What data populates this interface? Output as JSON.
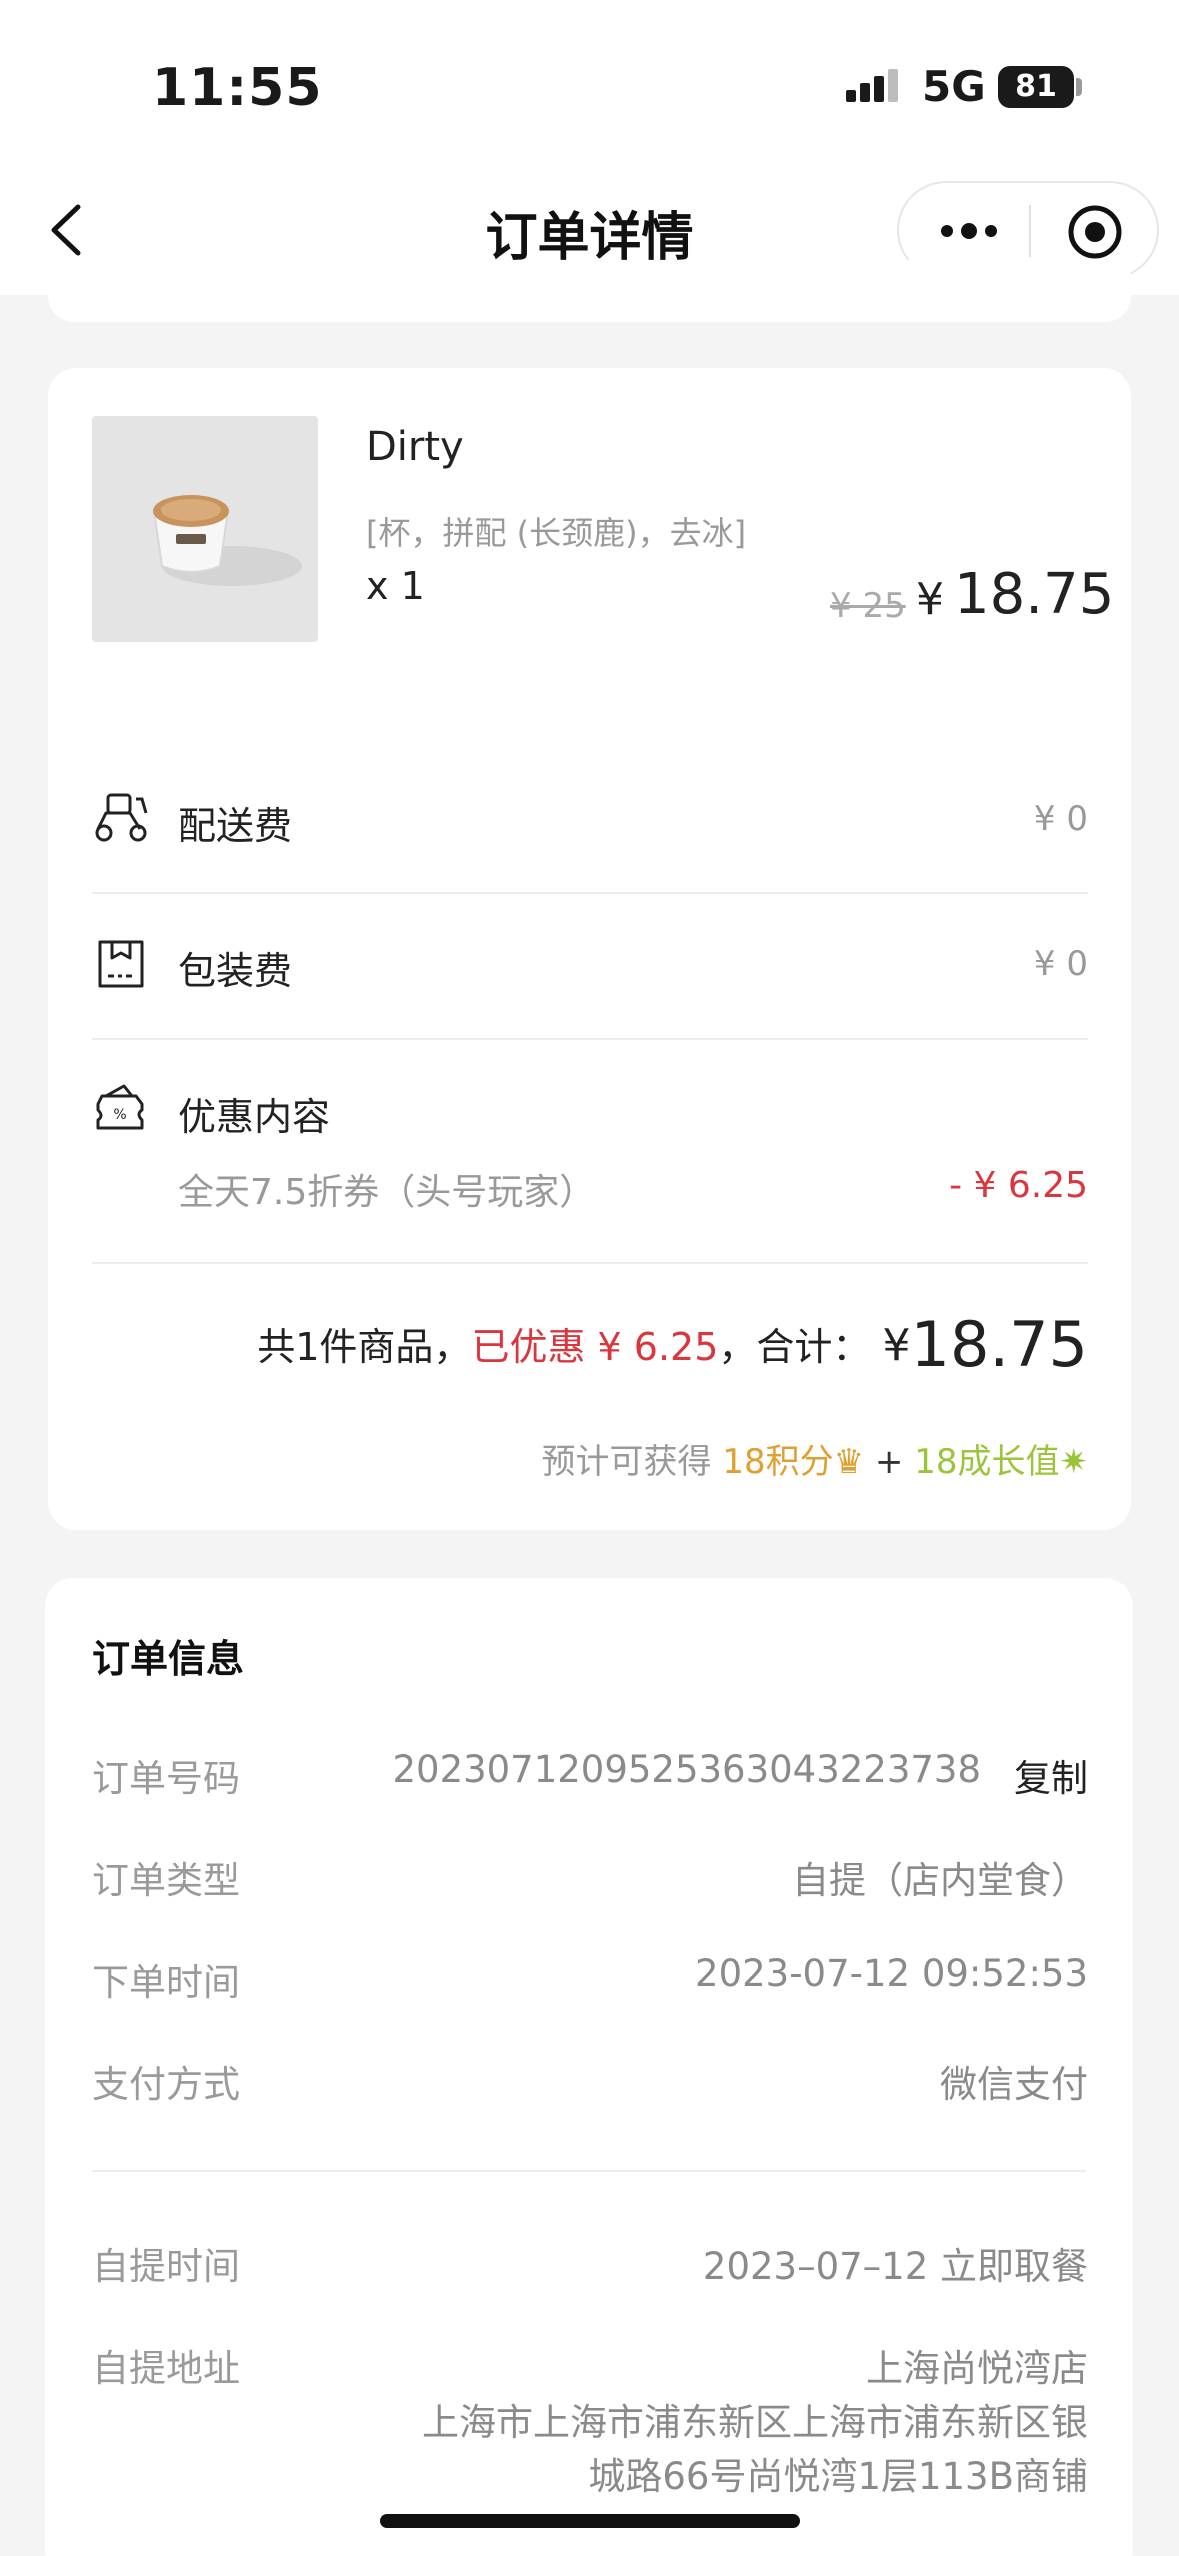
{
  "status_bar": {
    "time": "11:55",
    "network": "5G",
    "battery": "81"
  },
  "nav": {
    "title": "订单详情"
  },
  "product": {
    "name": "Dirty",
    "spec": "[杯，拼配 (长颈鹿)，去冰]",
    "qty": "x 1",
    "original_price": "¥ 25",
    "price_symbol": "¥",
    "price": "18.75"
  },
  "fees": {
    "delivery_label": "配送费",
    "delivery_value": "¥ 0",
    "packaging_label": "包装费",
    "packaging_value": "¥ 0",
    "discount_label": "优惠内容",
    "discount_name": "全天7.5折券（头号玩家）",
    "discount_value": "- ¥ 6.25"
  },
  "summary": {
    "count_text": "共1件商品，",
    "saved_text": "已优惠 ¥ 6.25",
    "total_label": "，合计：",
    "total_symbol": "¥",
    "total": "18.75",
    "points_prefix": "预计可获得",
    "points": "18积分",
    "plus": "+",
    "growth": "18成长值"
  },
  "order_info": {
    "title": "订单信息",
    "number_label": "订单号码",
    "number_value": "2023071209525363043223738",
    "copy_label": "复制",
    "type_label": "订单类型",
    "type_value": "自提（店内堂食）",
    "time_label": "下单时间",
    "time_value": "2023-07-12 09:52:53",
    "pay_label": "支付方式",
    "pay_value": "微信支付",
    "pickup_time_label": "自提时间",
    "pickup_time_value": "2023–07–12 立即取餐",
    "pickup_addr_label": "自提地址",
    "pickup_addr_store": "上海尚悦湾店",
    "pickup_addr_line1": "上海市上海市浦东新区上海市浦东新区银",
    "pickup_addr_line2": "城路66号尚悦湾1层113B商铺"
  },
  "colors": {
    "accent_red": "#d9363e",
    "points_orange": "#e0a030",
    "growth_green": "#9cc43a"
  }
}
